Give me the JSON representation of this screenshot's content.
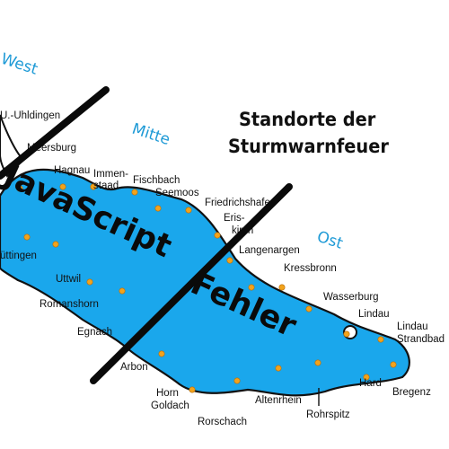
{
  "title": {
    "line1": "Standorte der",
    "line2": "Sturmwarnfeuer"
  },
  "regions": {
    "west": "West",
    "mitte": "Mitte",
    "ost": "Ost"
  },
  "places": {
    "uhldingen": "U.-Uhldingen",
    "meersburg": "Meersburg",
    "hagnau": "Hagnau",
    "immenstaad_1": "Immen-",
    "immenstaad_2": "staad",
    "fischbach": "Fischbach",
    "seemoos": "Seemoos",
    "friedrichshafen": "Friedrichshafen",
    "eriskirch_1": "Eris-",
    "eriskirch_2": "kirch",
    "langenargen": "Langenargen",
    "kressbronn": "Kressbronn",
    "wasserburg": "Wasserburg",
    "lindau": "Lindau",
    "lindau_strandbad_1": "Lindau",
    "lindau_strandbad_2": "Strandbad",
    "bregenz": "Bregenz",
    "hard": "Hard",
    "rohrspitz": "Rohrspitz",
    "altenrhein": "Altenrhein",
    "rorschach": "Rorschach",
    "horn": "Horn",
    "goldach": "Goldach",
    "arbon": "Arbon",
    "egnach": "Egnach",
    "romanshorn": "Romanshorn",
    "uttwil": "Uttwil",
    "guettingen": "üttingen"
  },
  "error_overlay": {
    "line1": "JavaScript",
    "line2": "Fehler"
  },
  "colors": {
    "lake": "#1aa7ec",
    "shore": "#111111",
    "region_label": "#1e9ad6",
    "beacon": "#f2a31c",
    "cross": "#0a0a0a"
  },
  "icons": {
    "beacon": "storm-warning-beacon-icon"
  }
}
